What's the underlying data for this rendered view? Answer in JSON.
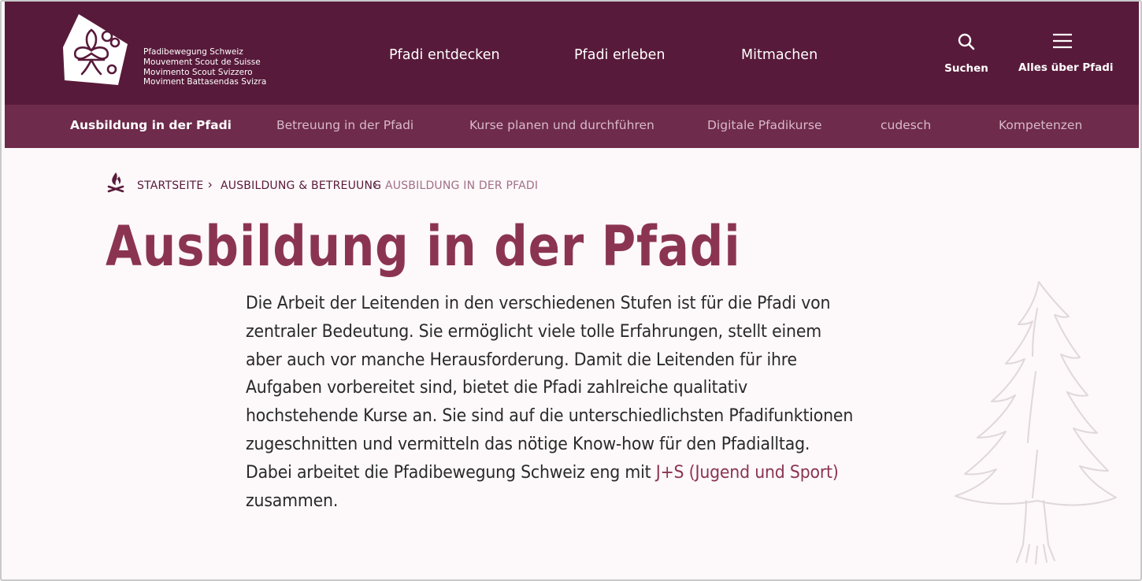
{
  "header": {
    "logo_lines": [
      "Pfadibewegung Schweiz",
      "Mouvement Scout de Suisse",
      "Movimento Scout Svizzero",
      "Moviment Battasendas Svizra"
    ],
    "nav": [
      "Pfadi entdecken",
      "Pfadi erleben",
      "Mitmachen"
    ],
    "search_label": "Suchen",
    "menu_label": "Alles über Pfadi"
  },
  "subnav": {
    "items": [
      "Ausbildung in der Pfadi",
      "Betreuung in der Pfadi",
      "Kurse planen und durchführen",
      "Digitale Pfadikurse",
      "cudesch",
      "Kompetenzen"
    ],
    "active_index": 0
  },
  "breadcrumb": {
    "items": [
      "STARTSEITE",
      "AUSBILDUNG & BETREUUNG",
      "AUSBILDUNG IN DER PFADI"
    ]
  },
  "page": {
    "title": "Ausbildung in der Pfadi",
    "intro_text": "Die Arbeit der Leitenden in den verschiedenen Stufen ist für die Pfadi von zentraler Bedeutung. Sie ermöglicht viele tolle Erfahrungen, stellt einem aber auch vor manche Herausforderung. Damit die Leitenden für ihre Aufgaben vorbereitet sind, bietet die Pfadi zahlreiche qualitativ hochstehende Kurse an. Sie sind auf die unterschiedlichsten Pfadifunktionen zugeschnitten und vermitteln das nötige Know-how für den Pfadialltag. Dabei arbeitet die Pfadibewegung Schweiz eng mit",
    "intro_link": "J+S (Jugend und Sport)",
    "intro_end": "zusammen."
  },
  "colors": {
    "header_bg": "#581a3a",
    "subnav_bg": "#6e2b4c",
    "accent": "#8b3452",
    "page_bg": "#fdf8f9"
  }
}
